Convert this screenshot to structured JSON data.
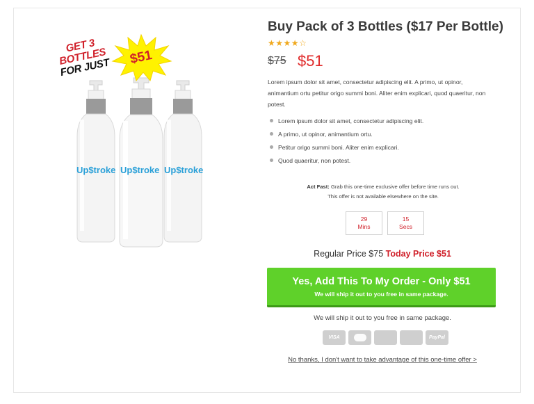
{
  "product": {
    "title": "Buy Pack of 3 Bottles ($17 Per Bottle)",
    "rating": {
      "value": 4,
      "max": 5
    },
    "old_price": "$75",
    "new_price": "$51",
    "description": "Lorem ipsum dolor sit amet, consectetur adipiscing elit. A primo, ut opinor, animantium ortu petitur origo summi boni. Aliter enim explicari, quod quaeritur, non potest.",
    "bullets": [
      "Lorem ipsum dolor sit amet, consectetur adipiscing elit.",
      "A primo, ut opinor, animantium ortu.",
      "Petitur origo summi boni. Aliter enim explicari.",
      "Quod quaeritur, non potest."
    ]
  },
  "image": {
    "promo_line1": "GET 3 BOTTLES",
    "promo_line2": "FOR JUST",
    "promo_price": "$51",
    "brand": "Up$troke"
  },
  "act_fast": {
    "label": "Act Fast:",
    "text": "Grab this one-time exclusive offer before time runs out.",
    "text2": "This offer is not available elsewhere on the site."
  },
  "countdown": [
    {
      "value": "29",
      "unit": "Mins"
    },
    {
      "value": "15",
      "unit": "Secs"
    }
  ],
  "pricing": {
    "regular_label": "Regular Price $75",
    "today_label": "Today Price $51"
  },
  "cta": {
    "main": "Yes, Add This To My Order - Only $51",
    "sub": "We will ship it out to you free in same package."
  },
  "ship_note": "We will ship it out to you free in same package.",
  "payments": [
    "VISA",
    "",
    "",
    "",
    "PayPal"
  ],
  "no_thanks": "No thanks, I don't want to take advantage of this one-time offer >",
  "colors": {
    "accent_red": "#e02a2a",
    "cta_green": "#5fd12a",
    "star": "#f0a81c",
    "starburst": "#fff200"
  }
}
